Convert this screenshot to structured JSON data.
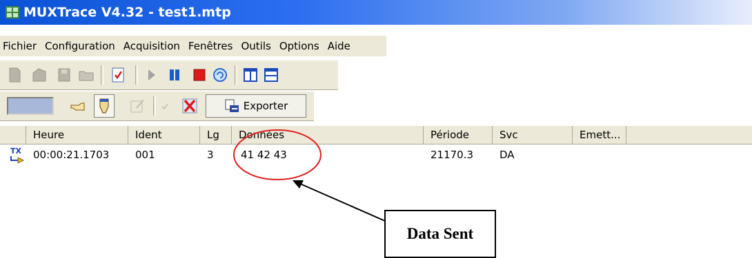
{
  "window": {
    "title": "MUXTrace V4.32  - test1.mtp"
  },
  "menu": [
    "Fichier",
    "Configuration",
    "Acquisition",
    "Fenêtres",
    "Outils",
    "Options",
    "Aide"
  ],
  "toolbar2": {
    "export_label": "Exporter"
  },
  "table": {
    "columns": [
      "Heure",
      "Ident",
      "Lg",
      "Données",
      "Période",
      "Svc",
      "Emett..."
    ],
    "rows": [
      {
        "dir_icon": "tx-arrow-icon",
        "heure": "00:00:21.1703",
        "ident": "001",
        "lg": "3",
        "donnees": "41 42 43",
        "periode": "21170.3",
        "svc": "DA",
        "emett": ""
      }
    ]
  },
  "annotation": {
    "label": "Data Sent",
    "ellipse_color": "#e02020"
  }
}
